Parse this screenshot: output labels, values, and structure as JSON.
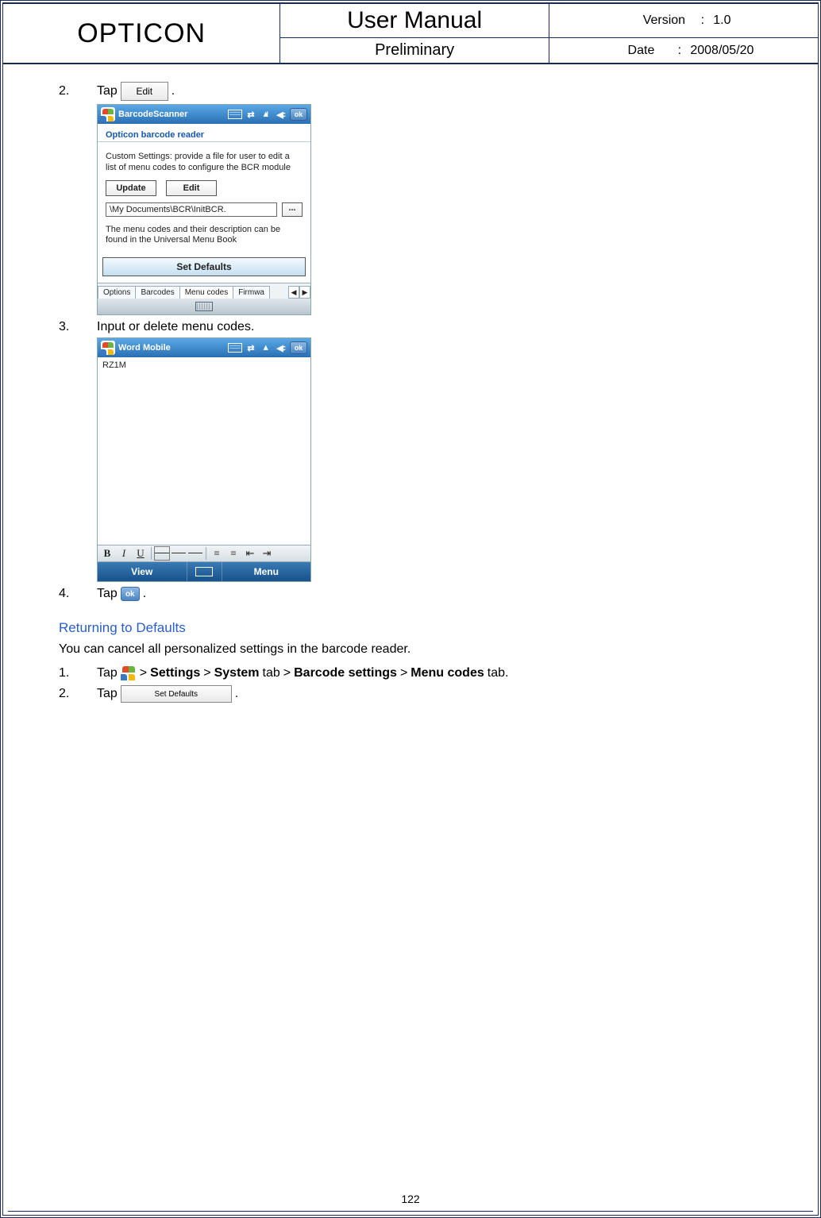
{
  "header": {
    "brand": "OPTICON",
    "title": "User Manual",
    "subtitle": "Preliminary",
    "version_label": "Version",
    "version_value": "1.0",
    "date_label": "Date",
    "date_value": "2008/05/20"
  },
  "steps": {
    "n2": "2.",
    "n3": "3.",
    "n4": "4.",
    "s1_num": "1.",
    "s2_num": "2.",
    "tap": "Tap",
    "period": ".",
    "edit_btn": "Edit",
    "step3_text": "Input or delete menu codes.",
    "ok": "ok",
    "gt": ">",
    "settings": "Settings",
    "system": "System",
    "tab_word": "tab",
    "barcode_settings": "Barcode settings",
    "menu_codes": "Menu codes",
    "tab_period": "tab.",
    "set_defaults_btn": "Set Defaults"
  },
  "section": {
    "returning_heading": "Returning to Defaults",
    "returning_para": "You can cancel all personalized settings in the barcode reader."
  },
  "ss1": {
    "title": "BarcodeScanner",
    "subtitle": "Opticon barcode reader",
    "para1": "Custom Settings: provide a file for user to edit a list of menu codes to configure the BCR module",
    "btn_update": "Update",
    "btn_edit": "Edit",
    "path": "\\My Documents\\BCR\\InitBCR.",
    "browse": "...",
    "para2": "The menu codes and their description can be found in the Universal Menu Book",
    "btn_set_defaults": "Set Defaults",
    "tabs": {
      "options": "Options",
      "barcodes": "Barcodes",
      "menu": "Menu codes",
      "firmware": "Firmwa"
    },
    "scroll_left": "◀",
    "scroll_right": "▶",
    "ok": "ok"
  },
  "ss2": {
    "title": "Word Mobile",
    "body_text": "RZ1M",
    "ok": "ok",
    "fmt": {
      "b": "B",
      "i": "I",
      "u": "U"
    },
    "menu": {
      "view": "View",
      "menu": "Menu"
    }
  },
  "page_number": "122"
}
